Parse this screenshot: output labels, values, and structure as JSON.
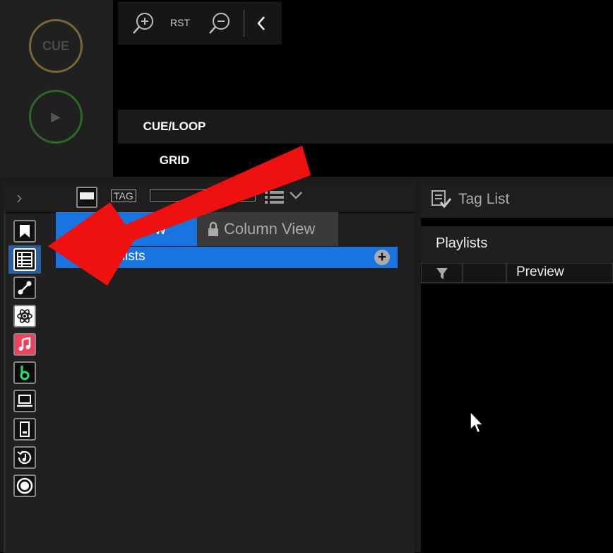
{
  "deck": {
    "cue_label": "CUE",
    "play_glyph": "▶"
  },
  "zoom": {
    "zoom_in_icon": "zoom-in-icon",
    "rst_label": "RST",
    "zoom_out_icon": "zoom-out-icon",
    "collapse_icon": "chevron-left-icon"
  },
  "tabs": {
    "cue_loop": "CUE/LOOP",
    "grid": "GRID"
  },
  "browser_header": {
    "expand_glyph": "›",
    "tag_label": "TAG"
  },
  "view_tabs": {
    "tree_view": "ew",
    "column_view": "Column View"
  },
  "tree": {
    "playlists": "Playlists"
  },
  "sidebar": {
    "items": [
      {
        "icon": "bookmark-icon"
      },
      {
        "icon": "collection-list-icon"
      },
      {
        "icon": "link-icon"
      },
      {
        "icon": "atom-icon"
      },
      {
        "icon": "music-note-icon"
      },
      {
        "icon": "beatport-icon"
      },
      {
        "icon": "laptop-icon"
      },
      {
        "icon": "device-icon"
      },
      {
        "icon": "history-icon"
      },
      {
        "icon": "record-icon"
      }
    ]
  },
  "right_panel": {
    "tag_list_label": "Tag List",
    "playlists_label": "Playlists",
    "preview_label": "Preview"
  },
  "colors": {
    "accent_blue": "#1a74e0",
    "arrow_red": "#ef1010"
  }
}
